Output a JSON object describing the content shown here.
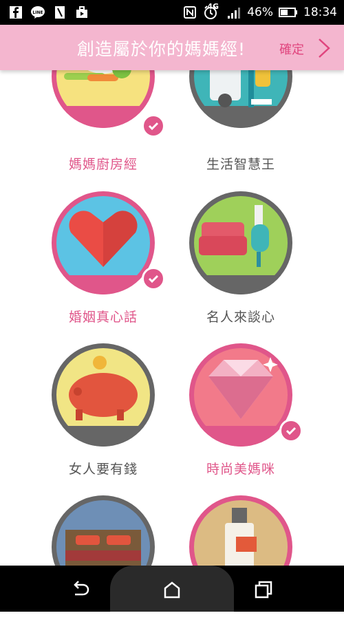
{
  "status_bar": {
    "battery": "46%",
    "time": "18:34",
    "network": "4G",
    "icons": [
      "facebook-icon",
      "line-icon",
      "note-icon",
      "briefcase-icon",
      "nfc-icon",
      "alarm-icon",
      "signal-icon",
      "battery-icon"
    ]
  },
  "header": {
    "title": "創造屬於你的媽媽經!",
    "confirm_label": "確定"
  },
  "categories": [
    {
      "label": "媽媽廚房經",
      "selected": true
    },
    {
      "label": "生活智慧王",
      "selected": false
    },
    {
      "label": "婚姻真心話",
      "selected": true
    },
    {
      "label": "名人來談心",
      "selected": false
    },
    {
      "label": "女人要有錢",
      "selected": false
    },
    {
      "label": "時尚美媽咪",
      "selected": true
    },
    {
      "label": "",
      "selected": false
    },
    {
      "label": "",
      "selected": false
    }
  ],
  "colors": {
    "accent": "#e0568a",
    "header_bg": "#f4b6cf",
    "ring_selected": "#e0568a",
    "ring_unselected": "#666666"
  }
}
